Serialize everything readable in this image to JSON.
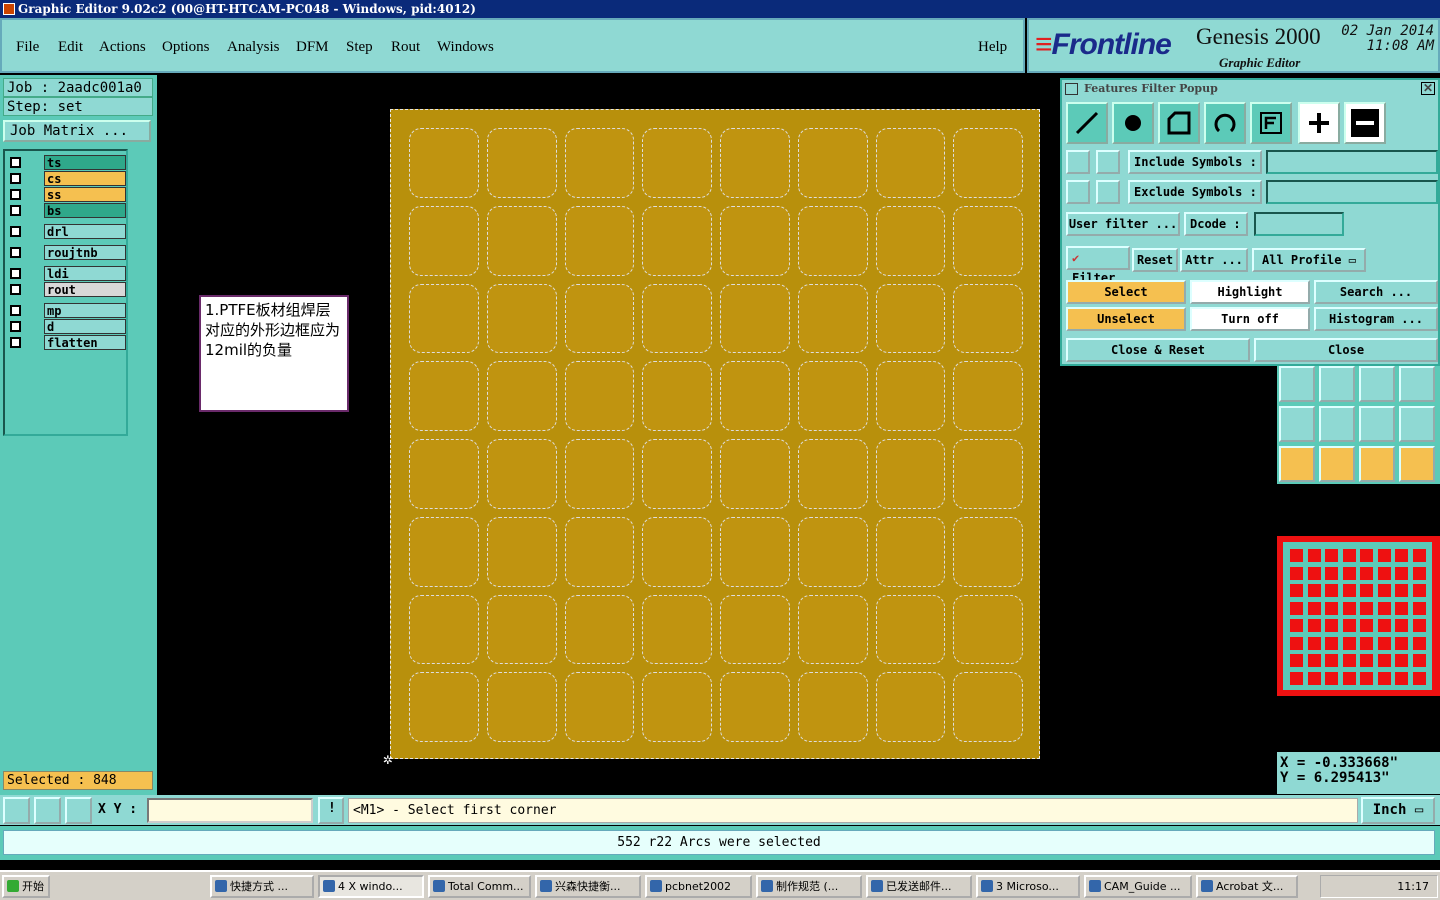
{
  "window": {
    "title": "Graphic Editor 9.02c2  (00@HT-HTCAM-PC048 - Windows, pid:4012)"
  },
  "menu": {
    "items": [
      "File",
      "Edit",
      "Actions",
      "Options",
      "Analysis",
      "DFM",
      "Step",
      "Rout",
      "Windows"
    ],
    "help": "Help"
  },
  "brand": {
    "logo": "Frontline",
    "product": "Genesis 2000",
    "sub": "Graphic Editor",
    "date": "02 Jan 2014",
    "time": "11:08 AM"
  },
  "job": {
    "job_label": "Job : 2aadc001a0",
    "step_label": "Step: set",
    "matrix_button": "Job Matrix ..."
  },
  "layers": [
    {
      "name": "ts",
      "color": "#2fa88a"
    },
    {
      "name": "cs",
      "color": "#f5c050"
    },
    {
      "name": "ss",
      "color": "#f5c050"
    },
    {
      "name": "bs",
      "color": "#2fa88a"
    },
    {
      "name": "drl",
      "color": "#8fd9d3"
    },
    {
      "name": "roujtnb",
      "color": "#8fd9d3"
    },
    {
      "name": "ldi",
      "color": "#8fd9d3"
    },
    {
      "name": "rout",
      "color": "#d8d8d8"
    },
    {
      "name": "mp",
      "color": "#8fd9d3"
    },
    {
      "name": "d",
      "color": "#8fd9d3"
    },
    {
      "name": "flatten",
      "color": "#8fd9d3"
    }
  ],
  "selected_count": "Selected : 848",
  "note": {
    "text": "1.PTFE板材组焊层对应的外形边框应为12mil的负量"
  },
  "board": {
    "rows": 8,
    "cols": 8,
    "board_color": "#b8900c"
  },
  "filter_popup": {
    "title": "Features Filter Popup",
    "include_symbols": "Include Symbols :",
    "exclude_symbols": "Exclude Symbols :",
    "user_filter": "User filter ...",
    "dcode": "Dcode :",
    "filter": "Filter",
    "reset": "Reset",
    "attr": "Attr ...",
    "all_profile": "All Profile",
    "select": "Select",
    "highlight": "Highlight",
    "search": "Search ...",
    "unselect": "Unselect",
    "turn_off": "Turn off",
    "histogram": "Histogram ...",
    "close_reset": "Close & Reset",
    "close": "Close"
  },
  "coords": {
    "x": "X = -0.333668\"",
    "y": "Y = 6.295413\""
  },
  "bottom": {
    "xy_label": "X Y :",
    "prompt": "<M1> - Select first corner",
    "units": "Inch"
  },
  "status_message": "552 r22 Arcs were selected",
  "taskbar": {
    "start": "开始",
    "tasks": [
      "快捷方式 ...",
      "4 X windo...",
      "Total Comm...",
      "兴森快捷衡...",
      "pcbnet2002",
      "制作规范 (...",
      "已发送邮件...",
      "3 Microso...",
      "CAM_Guide ...",
      "Acrobat 文..."
    ],
    "clock": "11:17"
  }
}
